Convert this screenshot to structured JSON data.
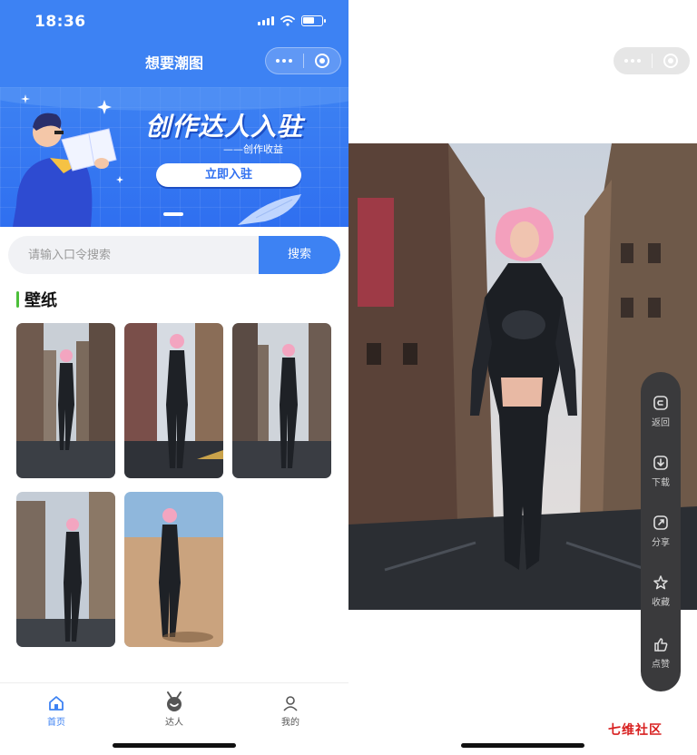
{
  "left_screen": {
    "status_bar": {
      "time": "18:36"
    },
    "nav": {
      "title": "想要潮图"
    },
    "banner": {
      "headline": "创作达人入驻",
      "subline": "——创作收益",
      "button_label": "立即入驻"
    },
    "search": {
      "placeholder": "请输入口令搜索",
      "button_label": "搜索"
    },
    "section": {
      "title": "壁纸"
    },
    "wallpapers": [
      {
        "name": "wallpaper-1"
      },
      {
        "name": "wallpaper-2"
      },
      {
        "name": "wallpaper-3"
      },
      {
        "name": "wallpaper-4"
      },
      {
        "name": "wallpaper-5"
      }
    ],
    "tabbar": {
      "items": [
        {
          "label": "首页",
          "icon": "home-icon",
          "active": true
        },
        {
          "label": "达人",
          "icon": "badge-icon",
          "active": false
        },
        {
          "label": "我的",
          "icon": "user-icon",
          "active": false
        }
      ]
    }
  },
  "right_screen": {
    "actions": [
      {
        "label": "返回",
        "icon": "back-icon"
      },
      {
        "label": "下载",
        "icon": "download-icon"
      },
      {
        "label": "分享",
        "icon": "share-icon"
      },
      {
        "label": "收藏",
        "icon": "star-icon"
      },
      {
        "label": "点赞",
        "icon": "thumbs-up-icon"
      }
    ]
  },
  "watermark": "七维社区",
  "colors": {
    "primary": "#3d82f3",
    "section_accent": "#4cbf3a",
    "action_bar": "#3a3a3c",
    "watermark": "#d82020"
  }
}
